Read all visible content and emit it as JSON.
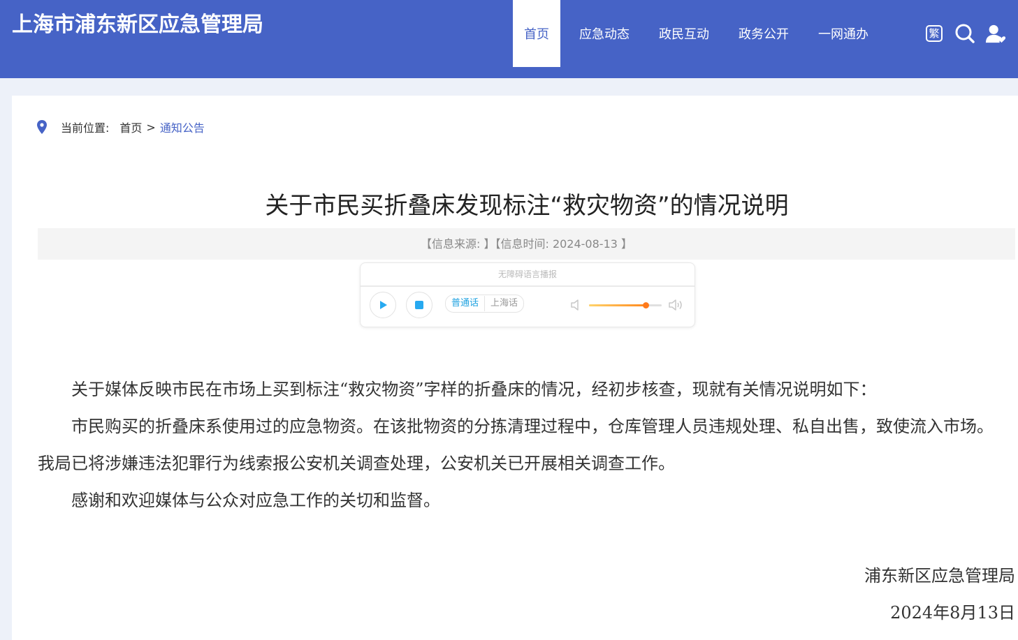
{
  "header": {
    "site_title": "上海市浦东新区应急管理局",
    "nav": [
      "首页",
      "应急动态",
      "政民互动",
      "政务公开",
      "一网通办"
    ],
    "active_nav": "首页",
    "icons": [
      "traditional-chinese-icon",
      "search-icon",
      "user-icon"
    ],
    "traditional_label": "繁",
    "brand_color": "#4663c6"
  },
  "breadcrumb": {
    "label": "当前位置:",
    "home": "首页",
    "separator": ">",
    "current": "通知公告"
  },
  "article": {
    "title": "关于市民买折叠床发现标注“救灾物资”的情况说明",
    "meta": "【信息来源: 】【信息时间: 2024-08-13 】",
    "paragraphs": [
      "关于媒体反映市民在市场上买到标注“救灾物资”字样的折叠床的情况，经初步核查，现就有关情况说明如下：",
      "市民购买的折叠床系使用过的应急物资。在该批物资的分拣清理过程中，仓库管理人员违规处理、私自出售，致使流入市场。我局已将涉嫌违法犯罪行为线索报公安机关调查处理，公安机关已开展相关调查工作。",
      "感谢和欢迎媒体与公众对应急工作的关切和监督。"
    ],
    "signature": "浦东新区应急管理局",
    "date": "2024年8月13日"
  },
  "player": {
    "title": "无障碍语言播报",
    "languages": [
      "普通话",
      "上海话"
    ],
    "selected_language": "普通话",
    "volume": 0.78,
    "accent_color": "#1fa2e0"
  }
}
